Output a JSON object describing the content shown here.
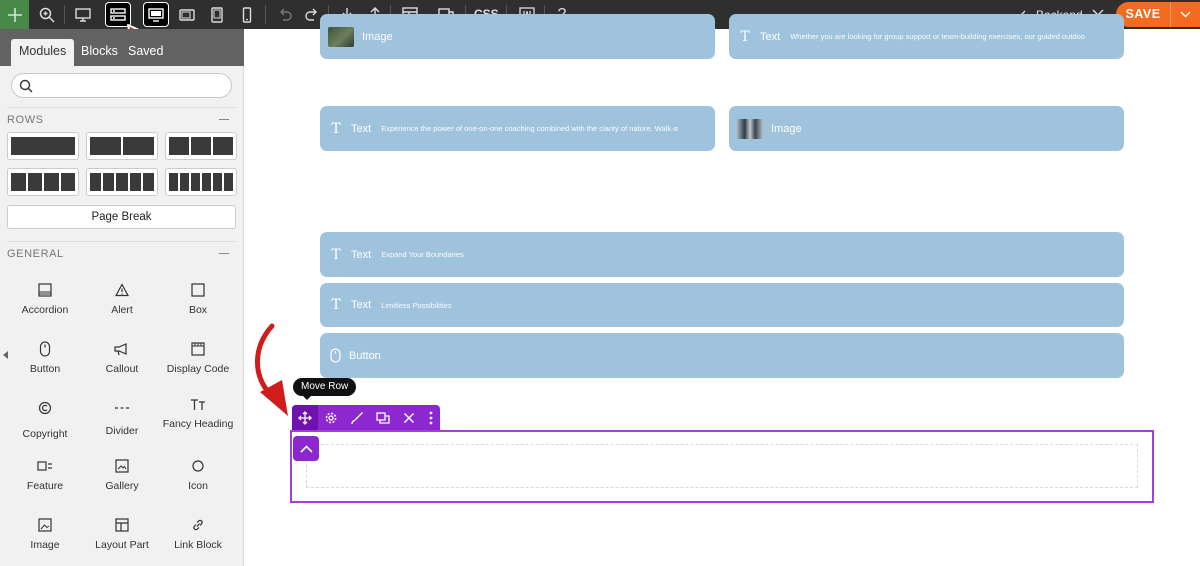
{
  "toolbar": {
    "css_label": "CSS",
    "backend_label": "Backend",
    "save_label": "SAVE",
    "help_label": "?"
  },
  "sidebar": {
    "tabs": [
      "Modules",
      "Blocks",
      "Saved"
    ],
    "search_placeholder": "",
    "rows_heading": "ROWS",
    "page_break_label": "Page Break",
    "general_heading": "GENERAL",
    "modules": [
      {
        "label": "Accordion",
        "icon": "accordion-icon"
      },
      {
        "label": "Alert",
        "icon": "alert-icon"
      },
      {
        "label": "Box",
        "icon": "box-icon"
      },
      {
        "label": "Button",
        "icon": "mouse-icon"
      },
      {
        "label": "Callout",
        "icon": "megaphone-icon"
      },
      {
        "label": "Display Code",
        "icon": "code-icon"
      },
      {
        "label": "Copyright",
        "icon": "copyright-icon"
      },
      {
        "label": "Divider",
        "icon": "divider-icon"
      },
      {
        "label": "Fancy Heading",
        "icon": "fancy-heading-icon"
      },
      {
        "label": "Feature",
        "icon": "feature-icon"
      },
      {
        "label": "Gallery",
        "icon": "gallery-icon"
      },
      {
        "label": "Icon",
        "icon": "circle-icon"
      },
      {
        "label": "Image",
        "icon": "image-icon"
      },
      {
        "label": "Layout Part",
        "icon": "layout-icon"
      },
      {
        "label": "Link Block",
        "icon": "link-icon"
      }
    ]
  },
  "canvas": {
    "cards": [
      {
        "type": "Image",
        "sub": ""
      },
      {
        "type": "Text",
        "sub": "Whether you are looking for group support or team-building exercises, our guided outdoo"
      },
      {
        "type": "Text",
        "sub": "Experience the power of one-on-one coaching combined with the clarity of nature. Walk-a"
      },
      {
        "type": "Image",
        "sub": ""
      },
      {
        "type": "Text",
        "sub": "Expand Your Boundaries"
      },
      {
        "type": "Text",
        "sub": "Limitless Possibilities"
      },
      {
        "type": "Button",
        "sub": ""
      }
    ],
    "tooltip": "Move Row"
  },
  "colors": {
    "accent": "#f26b21",
    "row_purple": "#8d27cf",
    "card_blue": "#9fc3dd",
    "toolbar_dark": "#2f2f2f"
  }
}
